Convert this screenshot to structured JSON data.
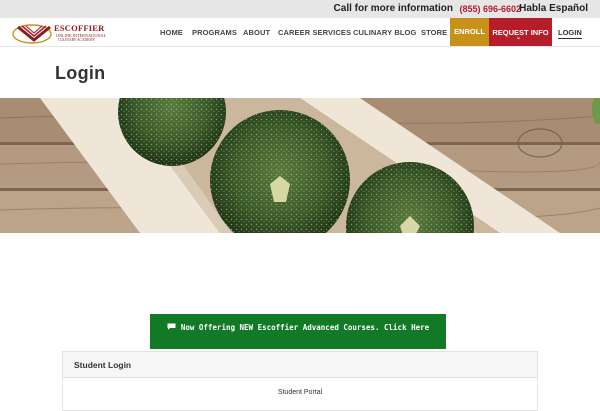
{
  "topbar": {
    "call_text": "Call for more information",
    "phone": "(855) 696-6602",
    "habla": "Habla Español"
  },
  "logo": {
    "line1": "ESCOFFIER",
    "line2": "ONLINE INTERNATIONAL",
    "line3": "CULINARY ACADEMY"
  },
  "nav": {
    "items": [
      "HOME",
      "PROGRAMS",
      "ABOUT",
      "CAREER SERVICES",
      "CULINARY BLOG",
      "STORE"
    ],
    "enroll": "ENROLL",
    "request": "REQUEST INFO",
    "login": "LOGIN"
  },
  "page": {
    "title": "Login"
  },
  "banner": {
    "text": "Now Offering NEW Escoffier Advanced Courses. Click Here"
  },
  "login_card": {
    "header": "Student Login",
    "portal_label": "Student Portal"
  },
  "colors": {
    "topbar_bg": "#e6e6e6",
    "phone": "#b01d2e",
    "enroll_bg": "#c7911a",
    "request_bg": "#b51d2a",
    "banner_bg": "#127a27",
    "brand": "#8c1b22"
  }
}
